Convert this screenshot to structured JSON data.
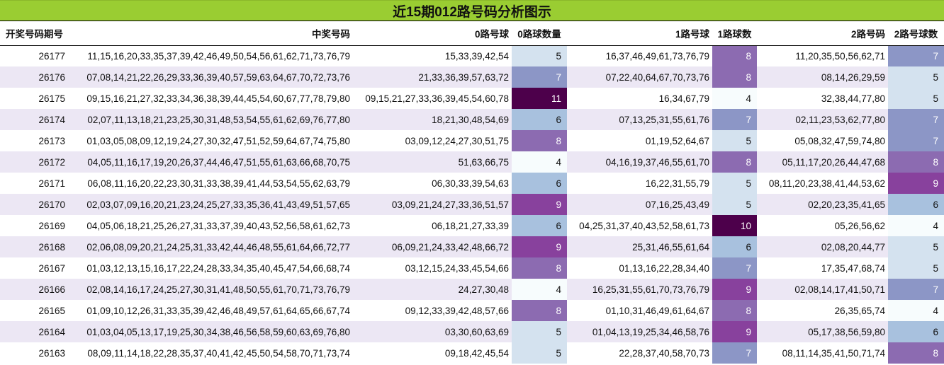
{
  "title": "近15期012路号码分析图示",
  "headers": [
    "开奖号码期号",
    "中奖号码",
    "0路号球",
    "0路球数量",
    "1路号球",
    "1路球数",
    "2路号码",
    "2路号球数"
  ],
  "rows": [
    {
      "issue": "26177",
      "numbers": "11,15,16,20,33,35,37,39,42,46,49,50,54,56,61,62,71,73,76,79",
      "r0": "15,33,39,42,54",
      "c0": 5,
      "r1": "16,37,46,49,61,73,76,79",
      "c1": 8,
      "r2": "11,20,35,50,56,62,71",
      "c2": 7
    },
    {
      "issue": "26176",
      "numbers": "07,08,14,21,22,26,29,33,36,39,40,57,59,63,64,67,70,72,73,76",
      "r0": "21,33,36,39,57,63,72",
      "c0": 7,
      "r1": "07,22,40,64,67,70,73,76",
      "c1": 8,
      "r2": "08,14,26,29,59",
      "c2": 5
    },
    {
      "issue": "26175",
      "numbers": "09,15,16,21,27,32,33,34,36,38,39,44,45,54,60,67,77,78,79,80",
      "r0": "09,15,21,27,33,36,39,45,54,60,78",
      "c0": 11,
      "r1": "16,34,67,79",
      "c1": 4,
      "r2": "32,38,44,77,80",
      "c2": 5
    },
    {
      "issue": "26174",
      "numbers": "02,07,11,13,18,21,23,25,30,31,48,53,54,55,61,62,69,76,77,80",
      "r0": "18,21,30,48,54,69",
      "c0": 6,
      "r1": "07,13,25,31,55,61,76",
      "c1": 7,
      "r2": "02,11,23,53,62,77,80",
      "c2": 7
    },
    {
      "issue": "26173",
      "numbers": "01,03,05,08,09,12,19,24,27,30,32,47,51,52,59,64,67,74,75,80",
      "r0": "03,09,12,24,27,30,51,75",
      "c0": 8,
      "r1": "01,19,52,64,67",
      "c1": 5,
      "r2": "05,08,32,47,59,74,80",
      "c2": 7
    },
    {
      "issue": "26172",
      "numbers": "04,05,11,16,17,19,20,26,37,44,46,47,51,55,61,63,66,68,70,75",
      "r0": "51,63,66,75",
      "c0": 4,
      "r1": "04,16,19,37,46,55,61,70",
      "c1": 8,
      "r2": "05,11,17,20,26,44,47,68",
      "c2": 8
    },
    {
      "issue": "26171",
      "numbers": "06,08,11,16,20,22,23,30,31,33,38,39,41,44,53,54,55,62,63,79",
      "r0": "06,30,33,39,54,63",
      "c0": 6,
      "r1": "16,22,31,55,79",
      "c1": 5,
      "r2": "08,11,20,23,38,41,44,53,62",
      "c2": 9
    },
    {
      "issue": "26170",
      "numbers": "02,03,07,09,16,20,21,23,24,25,27,33,35,36,41,43,49,51,57,65",
      "r0": "03,09,21,24,27,33,36,51,57",
      "c0": 9,
      "r1": "07,16,25,43,49",
      "c1": 5,
      "r2": "02,20,23,35,41,65",
      "c2": 6
    },
    {
      "issue": "26169",
      "numbers": "04,05,06,18,21,25,26,27,31,33,37,39,40,43,52,56,58,61,62,73",
      "r0": "06,18,21,27,33,39",
      "c0": 6,
      "r1": "04,25,31,37,40,43,52,58,61,73",
      "c1": 10,
      "r2": "05,26,56,62",
      "c2": 4
    },
    {
      "issue": "26168",
      "numbers": "02,06,08,09,20,21,24,25,31,33,42,44,46,48,55,61,64,66,72,77",
      "r0": "06,09,21,24,33,42,48,66,72",
      "c0": 9,
      "r1": "25,31,46,55,61,64",
      "c1": 6,
      "r2": "02,08,20,44,77",
      "c2": 5
    },
    {
      "issue": "26167",
      "numbers": "01,03,12,13,15,16,17,22,24,28,33,34,35,40,45,47,54,66,68,74",
      "r0": "03,12,15,24,33,45,54,66",
      "c0": 8,
      "r1": "01,13,16,22,28,34,40",
      "c1": 7,
      "r2": "17,35,47,68,74",
      "c2": 5
    },
    {
      "issue": "26166",
      "numbers": "02,08,14,16,17,24,25,27,30,31,41,48,50,55,61,70,71,73,76,79",
      "r0": "24,27,30,48",
      "c0": 4,
      "r1": "16,25,31,55,61,70,73,76,79",
      "c1": 9,
      "r2": "02,08,14,17,41,50,71",
      "c2": 7
    },
    {
      "issue": "26165",
      "numbers": "01,09,10,12,26,31,33,35,39,42,46,48,49,57,61,64,65,66,67,74",
      "r0": "09,12,33,39,42,48,57,66",
      "c0": 8,
      "r1": "01,10,31,46,49,61,64,67",
      "c1": 8,
      "r2": "26,35,65,74",
      "c2": 4
    },
    {
      "issue": "26164",
      "numbers": "01,03,04,05,13,17,19,25,30,34,38,46,56,58,59,60,63,69,76,80",
      "r0": "03,30,60,63,69",
      "c0": 5,
      "r1": "01,04,13,19,25,34,46,58,76",
      "c1": 9,
      "r2": "05,17,38,56,59,80",
      "c2": 6
    },
    {
      "issue": "26163",
      "numbers": "08,09,11,14,18,22,28,35,37,40,41,42,45,50,54,58,70,71,73,74",
      "r0": "09,18,42,45,54",
      "c0": 5,
      "r1": "22,28,37,40,58,70,73",
      "c1": 7,
      "r2": "08,11,14,35,41,50,71,74",
      "c2": 8
    }
  ],
  "colors": {
    "title_bg": "#9acd32",
    "alt_row_bg": "#ece7f4",
    "count_scale": {
      "4": "#f7fcfd",
      "5": "#d4e2ef",
      "6": "#a8c1de",
      "7": "#8c96c6",
      "8": "#8c6bb1",
      "9": "#88419d",
      "10": "#4d004b",
      "11": "#4d004b"
    }
  }
}
